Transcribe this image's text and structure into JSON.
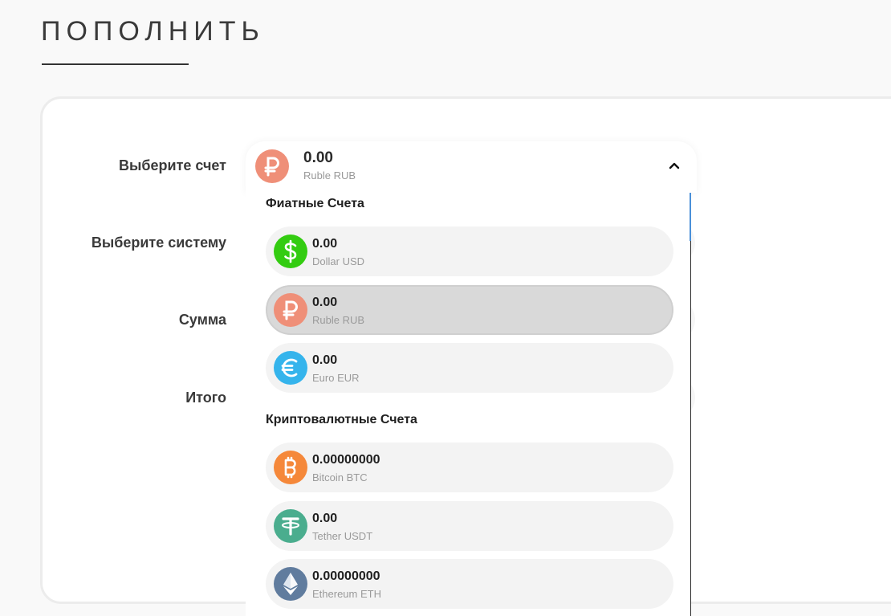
{
  "page": {
    "title": "ПОПОЛНИТЬ"
  },
  "form": {
    "labels": {
      "account": "Выберите счет",
      "system": "Выберите систему",
      "amount": "Сумма",
      "total": "Итого"
    }
  },
  "account_select": {
    "selected": {
      "amount": "0.00",
      "name": "Ruble RUB",
      "icon": "ruble-icon",
      "color": "#ef8f78"
    },
    "expanded": true,
    "groups": [
      {
        "title": "Фиатные Счета",
        "items": [
          {
            "amount": "0.00",
            "name": "Dollar USD",
            "icon": "dollar-icon",
            "color": "#33cc11",
            "selected": false
          },
          {
            "amount": "0.00",
            "name": "Ruble RUB",
            "icon": "ruble-icon",
            "color": "#ef8f78",
            "selected": true
          },
          {
            "amount": "0.00",
            "name": "Euro EUR",
            "icon": "euro-icon",
            "color": "#35b4ec",
            "selected": false
          }
        ]
      },
      {
        "title": "Криптовалютные Счета",
        "items": [
          {
            "amount": "0.00000000",
            "name": "Bitcoin BTC",
            "icon": "bitcoin-icon",
            "color": "#f5883a",
            "selected": false
          },
          {
            "amount": "0.00",
            "name": "Tether USDT",
            "icon": "tether-icon",
            "color": "#4aad8e",
            "selected": false
          },
          {
            "amount": "0.00000000",
            "name": "Ethereum ETH",
            "icon": "ethereum-icon",
            "color": "#607c9e",
            "selected": false
          }
        ]
      }
    ]
  }
}
